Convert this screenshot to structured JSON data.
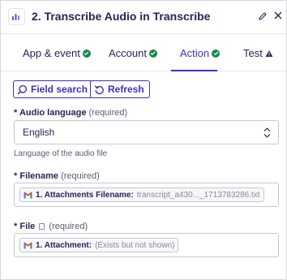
{
  "header": {
    "title": "2. Transcribe Audio in Transcribe"
  },
  "tabs": [
    {
      "label": "App & event",
      "status": "complete"
    },
    {
      "label": "Account",
      "status": "complete"
    },
    {
      "label": "Action",
      "status": "complete",
      "active": true
    },
    {
      "label": "Test",
      "status": "warning"
    }
  ],
  "toolbar": {
    "field_search_label": "Field search",
    "refresh_label": "Refresh"
  },
  "fields": {
    "audio_language": {
      "label": "Audio language",
      "required_text": "(required)",
      "value": "English",
      "help": "Language of the audio file"
    },
    "filename": {
      "label": "Filename",
      "required_text": "(required)",
      "pill_label": "1. Attachments Filename:",
      "pill_value": "transcript_a430..._1713783286.txt"
    },
    "file": {
      "label": "File",
      "required_text": "(required)",
      "pill_label": "1. Attachment:",
      "pill_value": "(Exists but not shown)"
    }
  },
  "colors": {
    "accent": "#3d2fc4",
    "success": "#118a4c",
    "text": "#2b2358"
  }
}
